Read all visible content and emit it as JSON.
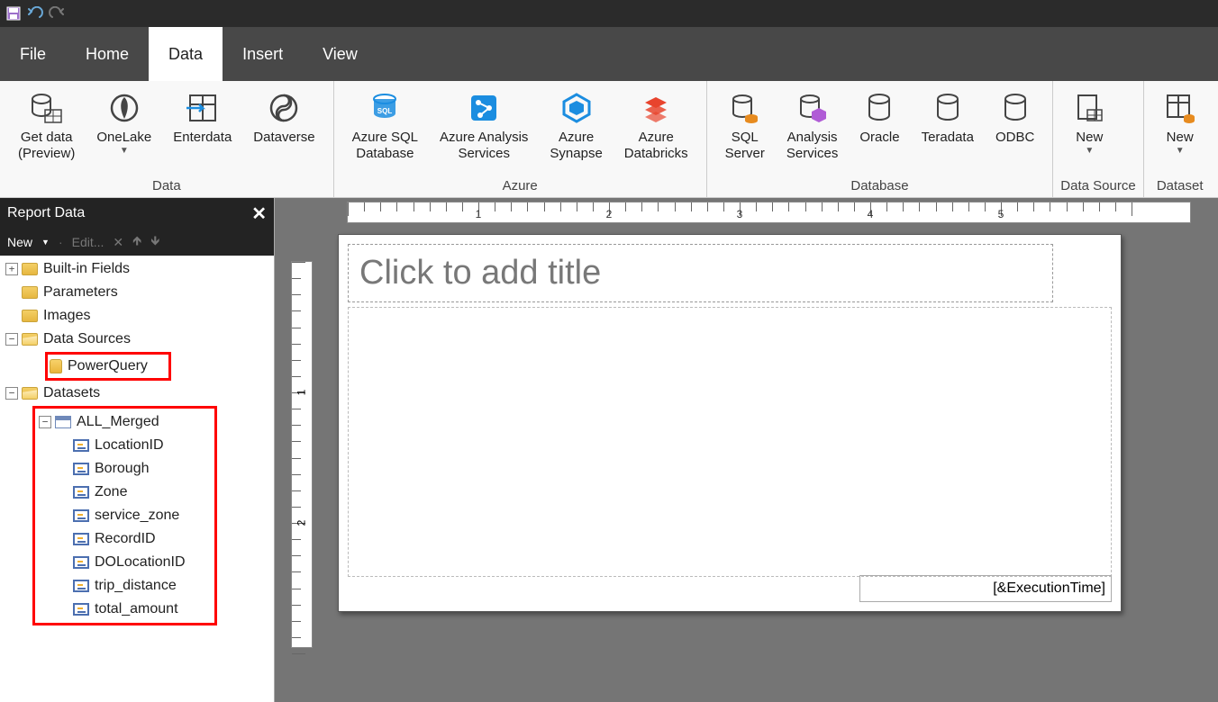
{
  "qat": {
    "save_title": "Save",
    "undo_title": "Undo",
    "redo_title": "Redo"
  },
  "menu": {
    "file": "File",
    "home": "Home",
    "data": "Data",
    "insert": "Insert",
    "view": "View"
  },
  "ribbon": {
    "group_data": "Data",
    "group_azure": "Azure",
    "group_database": "Database",
    "group_ds": "Data Source",
    "group_dataset": "Dataset",
    "btn_getdata": "Get data\n(Preview)",
    "btn_onelake": "OneLake",
    "btn_enterdata": "Enterdata",
    "btn_dataverse": "Dataverse",
    "btn_azsql": "Azure SQL\nDatabase",
    "btn_azanalysis": "Azure Analysis\nServices",
    "btn_azsynapse": "Azure\nSynapse",
    "btn_azdatabricks": "Azure\nDatabricks",
    "btn_sqlserver": "SQL\nServer",
    "btn_analysisservices": "Analysis\nServices",
    "btn_oracle": "Oracle",
    "btn_teradata": "Teradata",
    "btn_odbc": "ODBC",
    "btn_new_ds": "New",
    "btn_new_dataset": "New"
  },
  "panel": {
    "title": "Report Data",
    "new": "New",
    "edit": "Edit...",
    "tree": {
      "builtin": "Built-in Fields",
      "parameters": "Parameters",
      "images": "Images",
      "datasources": "Data Sources",
      "powerquery": "PowerQuery",
      "datasets": "Datasets",
      "allmerged": "ALL_Merged",
      "fields": [
        "LocationID",
        "Borough",
        "Zone",
        "service_zone",
        "RecordID",
        "DOLocationID",
        "trip_distance",
        "total_amount"
      ]
    }
  },
  "canvas": {
    "title_placeholder": "Click to add title",
    "footer_expr": "[&ExecutionTime]",
    "ruler_inches": [
      1,
      2,
      3,
      4,
      5
    ],
    "ruler_v": [
      1,
      2
    ]
  }
}
